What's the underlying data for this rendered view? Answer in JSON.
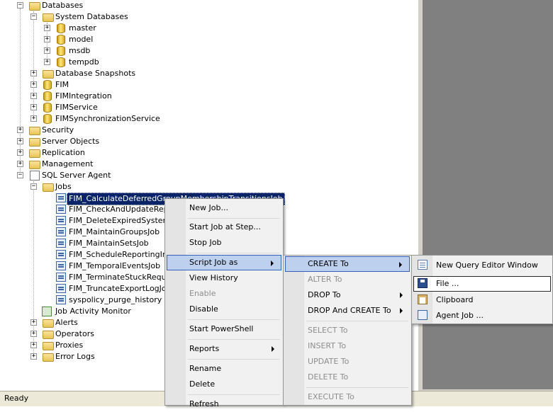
{
  "tree": {
    "databases": "Databases",
    "system_databases": "System Databases",
    "master": "master",
    "model": "model",
    "msdb": "msdb",
    "tempdb": "tempdb",
    "database_snapshots": "Database Snapshots",
    "fim": "FIM",
    "fim_integration": "FIMIntegration",
    "fim_service": "FIMService",
    "fim_sync": "FIMSynchronizationService",
    "security": "Security",
    "server_objects": "Server Objects",
    "replication": "Replication",
    "management": "Management",
    "sql_server_agent": "SQL Server Agent",
    "jobs": "Jobs",
    "job_items": [
      "FIM_CalculateDeferredGroupMembershipTransitionsJob",
      "FIM_CheckAndUpdateRepor",
      "FIM_DeleteExpiredSystemO",
      "FIM_MaintainGroupsJob",
      "FIM_MaintainSetsJob",
      "FIM_ScheduleReportingIncr",
      "FIM_TemporalEventsJob",
      "FIM_TerminateStuckReques",
      "FIM_TruncateExportLogJob",
      "syspolicy_purge_history"
    ],
    "job_activity_monitor": "Job Activity Monitor",
    "alerts": "Alerts",
    "operators": "Operators",
    "proxies": "Proxies",
    "error_logs": "Error Logs"
  },
  "context_menu": {
    "new_job": "New Job...",
    "start_job_at_step": "Start Job at Step...",
    "stop_job": "Stop Job",
    "script_job_as": "Script Job as",
    "view_history": "View History",
    "enable": "Enable",
    "disable": "Disable",
    "start_powershell": "Start PowerShell",
    "reports": "Reports",
    "rename": "Rename",
    "delete": "Delete",
    "refresh": "Refresh"
  },
  "script_menu": {
    "create_to": "CREATE To",
    "alter_to": "ALTER To",
    "drop_to": "DROP To",
    "drop_and_create_to": "DROP And CREATE To",
    "select_to": "SELECT To",
    "insert_to": "INSERT To",
    "update_to": "UPDATE To",
    "delete_to": "DELETE To",
    "execute_to": "EXECUTE To"
  },
  "create_menu": {
    "new_query_editor_window": "New Query Editor Window",
    "file": "File ...",
    "clipboard": "Clipboard",
    "agent_job": "Agent Job ..."
  },
  "status_bar": {
    "text": "Ready"
  },
  "colors": {
    "selection": "#0a246a",
    "menu_highlight": "#bdd0ee",
    "menu_highlight_border": "#3162b8",
    "right_pane": "#808080"
  }
}
